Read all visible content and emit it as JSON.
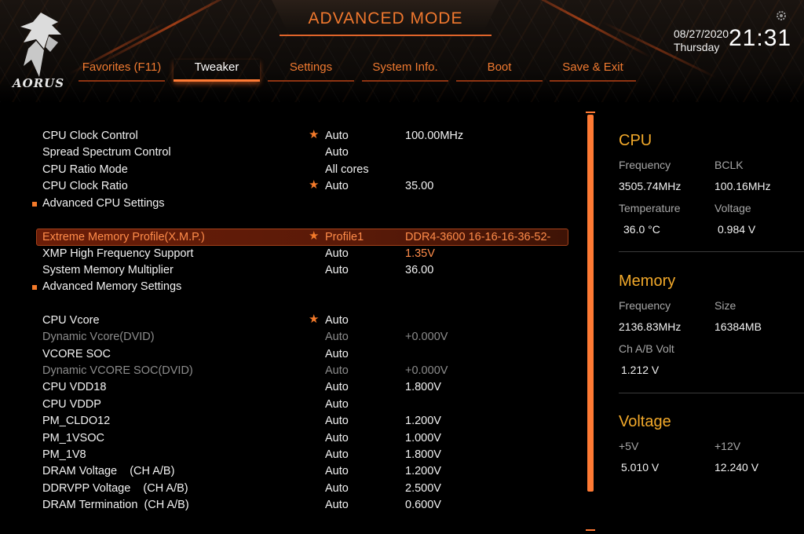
{
  "header": {
    "title": "ADVANCED MODE",
    "logo_text": "AORUS",
    "date": "08/27/2020",
    "day": "Thursday",
    "time": "21:31"
  },
  "tabs": [
    {
      "label": "Favorites (F11)"
    },
    {
      "label": "Tweaker"
    },
    {
      "label": "Settings"
    },
    {
      "label": "System Info."
    },
    {
      "label": "Boot"
    },
    {
      "label": "Save & Exit"
    }
  ],
  "active_tab": "Tweaker",
  "settings": [
    {
      "name": "CPU Clock Control",
      "star": "★",
      "value": "Auto",
      "value2": "100.00MHz"
    },
    {
      "name": "Spread Spectrum Control",
      "star": "",
      "value": "Auto",
      "value2": ""
    },
    {
      "name": "CPU Ratio Mode",
      "star": "",
      "value": "All cores",
      "value2": ""
    },
    {
      "name": "CPU Clock Ratio",
      "star": "★",
      "value": "Auto",
      "value2": "35.00"
    },
    {
      "name": "Advanced CPU Settings",
      "star": "",
      "value": "",
      "value2": ""
    },
    {
      "name": "Extreme Memory Profile(X.M.P.)",
      "star": "★",
      "value": "Profile1",
      "value2": "DDR4-3600 16-16-16-36-52-1.35V"
    },
    {
      "name": "XMP High Frequency Support",
      "star": "",
      "value": "Auto",
      "value2": ""
    },
    {
      "name": "System Memory Multiplier",
      "star": "",
      "value": "Auto",
      "value2": "36.00"
    },
    {
      "name": "Advanced Memory Settings",
      "star": "",
      "value": "",
      "value2": ""
    },
    {
      "name": "CPU Vcore",
      "star": "★",
      "value": "Auto",
      "value2": ""
    },
    {
      "name": "Dynamic Vcore(DVID)",
      "star": "",
      "value": "Auto",
      "value2": "+0.000V"
    },
    {
      "name": "VCORE SOC",
      "star": "",
      "value": "Auto",
      "value2": ""
    },
    {
      "name": "Dynamic VCORE SOC(DVID)",
      "star": "",
      "value": "Auto",
      "value2": "+0.000V"
    },
    {
      "name": "CPU VDD18",
      "star": "",
      "value": "Auto",
      "value2": "1.800V"
    },
    {
      "name": "CPU VDDP",
      "star": "",
      "value": "Auto",
      "value2": ""
    },
    {
      "name": "PM_CLDO12",
      "star": "",
      "value": "Auto",
      "value2": "1.200V"
    },
    {
      "name": "PM_1VSOC",
      "star": "",
      "value": "Auto",
      "value2": "1.000V"
    },
    {
      "name": "PM_1V8",
      "star": "",
      "value": "Auto",
      "value2": "1.800V"
    },
    {
      "name": "DRAM Voltage    (CH A/B)",
      "star": "",
      "value": "Auto",
      "value2": "1.200V"
    },
    {
      "name": "DDRVPP Voltage    (CH A/B)",
      "star": "",
      "value": "Auto",
      "value2": "2.500V"
    },
    {
      "name": "DRAM Termination  (CH A/B)",
      "star": "",
      "value": "Auto",
      "value2": "0.600V"
    }
  ],
  "info": {
    "cpu": {
      "title": "CPU",
      "frequency_label": "Frequency",
      "frequency": "3505.74MHz",
      "bclk_label": "BCLK",
      "bclk": "100.16MHz",
      "temperature_label": "Temperature",
      "temperature": "36.0 °C",
      "voltage_label": "Voltage",
      "voltage": "0.984 V"
    },
    "memory": {
      "title": "Memory",
      "frequency_label": "Frequency",
      "frequency": "2136.83MHz",
      "size_label": "Size",
      "size": "16384MB",
      "volt_label": "Ch A/B Volt",
      "volt": "1.212 V"
    },
    "voltage": {
      "title": "Voltage",
      "p5_label": "+5V",
      "p5": "5.010 V",
      "p12_label": "+12V",
      "p12": "12.240 V"
    }
  },
  "colors": {
    "accent": "#ff7a34",
    "header_title": "#f0782e",
    "panel_title": "#f2a92a",
    "selected_bg": "#6a1d08"
  },
  "icons": [
    "aorus-eagle-logo",
    "gear-icon",
    "star-icon",
    "bullet-square-icon"
  ]
}
